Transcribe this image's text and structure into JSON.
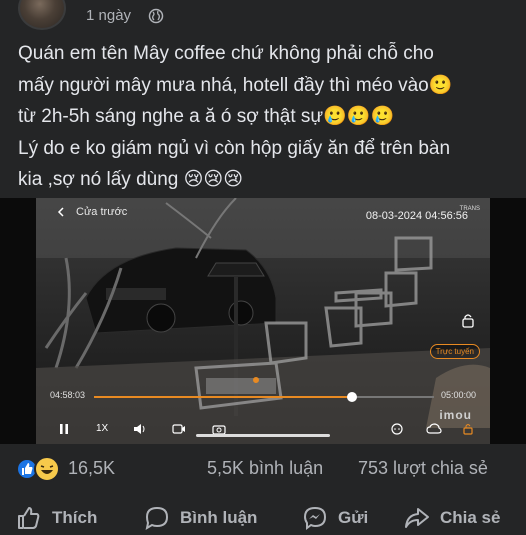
{
  "post": {
    "time": "1 ngày",
    "lines": [
      "Quán em tên Mây coffee chứ không phải chỗ cho",
      "mấy người mây mưa nhá, hotell đầy thì méo vào",
      "từ 2h-5h sáng nghe a ă ó sợ thật sự",
      "Lý do e ko giám ngủ vì còn hộp giấy ăn để trên bàn",
      "kia ,sợ nó lấy dùng"
    ],
    "emoji_smile": "🙂",
    "emoji_tears": "🥲🥲🥲",
    "emoji_cry": "😢😢😢"
  },
  "video": {
    "back_label": "Cửa trước",
    "datetime": "08-03-2024 04:56:56",
    "brand": "TRANS",
    "live_label": "Trực tuyến",
    "time_current": "04:58:03",
    "time_end": "05:00:00",
    "speed": "1X",
    "watermark": "imou",
    "progress": 0.76
  },
  "stats": {
    "reactions": "16,5K",
    "comments": "5,5K bình luận",
    "shares": "753 lượt chia sẻ"
  },
  "actions": {
    "like": "Thích",
    "comment": "Bình luận",
    "send": "Gửi",
    "share": "Chia sẻ"
  },
  "colors": {
    "background": "#242526",
    "text": "#e4e6eb",
    "muted": "#b0b3b8",
    "like_blue": "#1b74e4",
    "accent_orange": "#e88a22"
  },
  "icons": [
    "globe-icon",
    "back-icon",
    "lock-icon",
    "play-icon",
    "volume-icon",
    "record-icon",
    "camera-icon",
    "chat-icon",
    "cloud-icon",
    "like-icon",
    "haha-icon",
    "thumb-icon",
    "comment-icon",
    "messenger-icon",
    "share-icon"
  ]
}
